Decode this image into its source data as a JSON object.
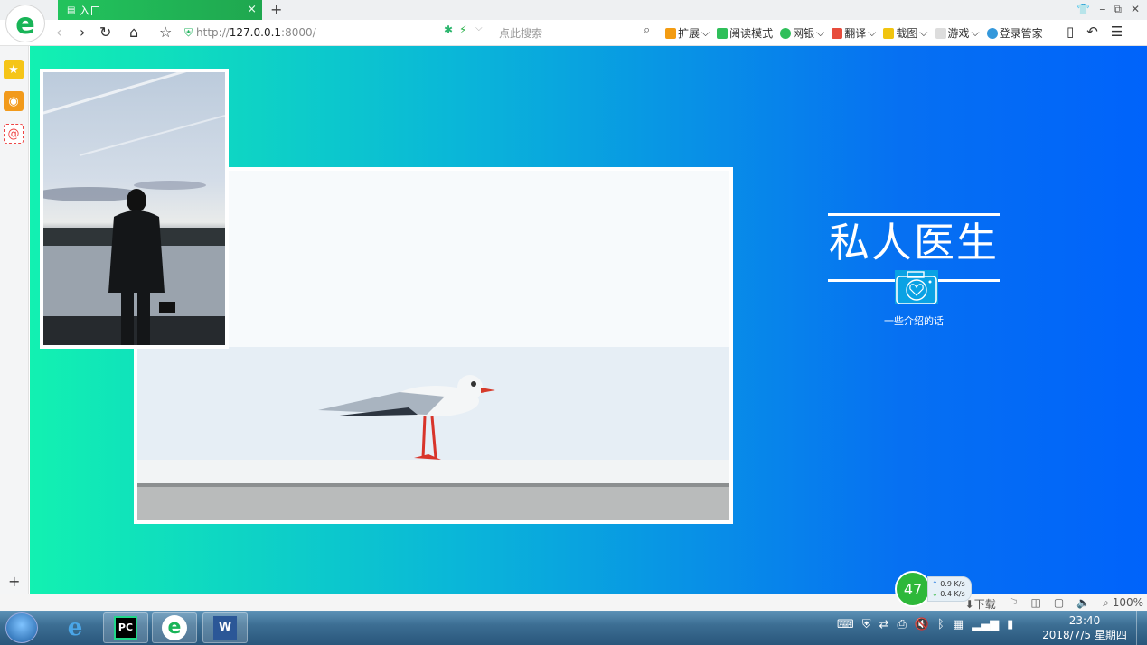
{
  "browser": {
    "tab_title": "入口",
    "tab_close": "×",
    "new_tab": "+",
    "url_prefix": "http://",
    "url_host": "127.0.0.1",
    "url_port": ":8000/",
    "search_placeholder": "点此搜索",
    "toolbar": [
      "扩展",
      "阅读模式",
      "网银",
      "翻译",
      "截图",
      "游戏",
      "登录管家"
    ],
    "window_controls": [
      "▢",
      "–",
      "⧉",
      "✕"
    ]
  },
  "page": {
    "title": "私人医生",
    "subtitle": "一些介绍的话"
  },
  "status": {
    "download": "下载",
    "zoom": "100%"
  },
  "speed_widget": {
    "percent": "47",
    "up": "0.9 K/s",
    "down": "0.4 K/s"
  },
  "taskbar": {
    "time": "23:40",
    "date": "2018/7/5 星期四"
  },
  "colors": {
    "gradient_start": "#12f1b1",
    "gradient_end": "#0063fb",
    "tab_green": "#22c35d"
  }
}
